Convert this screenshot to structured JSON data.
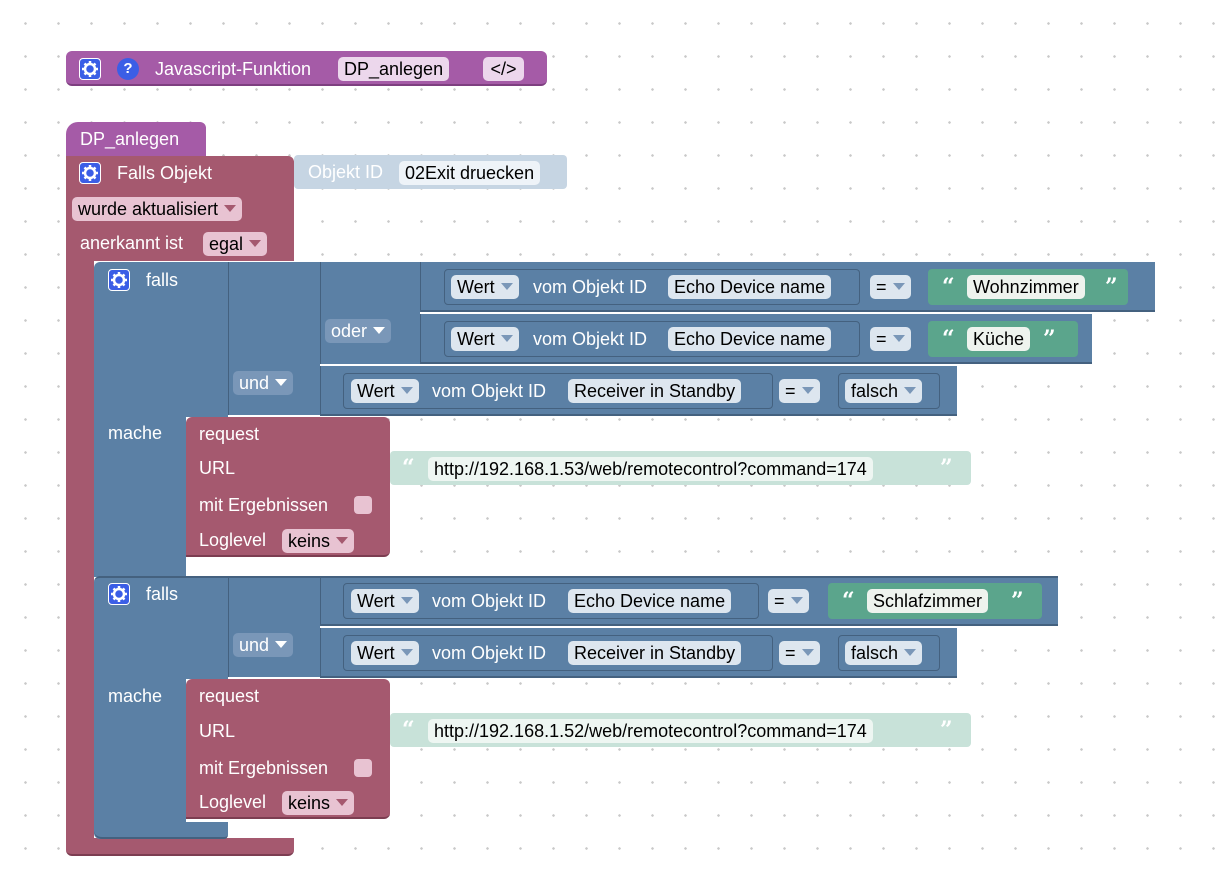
{
  "func_def": {
    "label": "Javascript-Funktion",
    "name": "DP_anlegen",
    "code_button": "</>"
  },
  "func_body": {
    "name": "DP_anlegen"
  },
  "trigger": {
    "label": "Falls Objekt",
    "mode": "wurde aktualisiert",
    "ack_label": "anerkannt ist",
    "ack_value": "egal",
    "object_id_label": "Objekt ID",
    "object_id_value": "02Exit druecken"
  },
  "if1": {
    "label": "falls",
    "do_label": "mache",
    "op_and": "und",
    "op_or": "oder",
    "cond1": {
      "prop": "Wert",
      "from": "vom Objekt ID",
      "id": "Echo Device name",
      "op": "=",
      "value": "Wohnzimmer"
    },
    "cond2": {
      "prop": "Wert",
      "from": "vom Objekt ID",
      "id": "Echo Device name",
      "op": "=",
      "value": "Küche"
    },
    "cond3": {
      "prop": "Wert",
      "from": "vom Objekt ID",
      "id": "Receiver in Standby",
      "op": "=",
      "value": "falsch"
    },
    "request": {
      "label": "request",
      "url_label": "URL",
      "url": "http://192.168.1.53/web/remotecontrol?command=174",
      "results_label": "mit Ergebnissen",
      "loglevel_label": "Loglevel",
      "loglevel": "keins"
    }
  },
  "if2": {
    "label": "falls",
    "do_label": "mache",
    "op_and": "und",
    "cond1": {
      "prop": "Wert",
      "from": "vom Objekt ID",
      "id": "Echo Device name",
      "op": "=",
      "value": "Schlafzimmer"
    },
    "cond2": {
      "prop": "Wert",
      "from": "vom Objekt ID",
      "id": "Receiver in Standby",
      "op": "=",
      "value": "falsch"
    },
    "request": {
      "label": "request",
      "url_label": "URL",
      "url": "http://192.168.1.52/web/remotecontrol?command=174",
      "results_label": "mit Ergebnissen",
      "loglevel_label": "Loglevel",
      "loglevel": "keins"
    }
  },
  "colors": {
    "function": "#a55ba7",
    "function_border": "#7e3f80",
    "trigger": "#a5596f",
    "trigger_border": "#7c3d51",
    "logic": "#5b80a5",
    "logic_border": "#44617f",
    "text": "#5ba58c",
    "text_light": "#c8e2d9",
    "object_light": "#c6d5e3",
    "gear": "#3b5ee6"
  }
}
